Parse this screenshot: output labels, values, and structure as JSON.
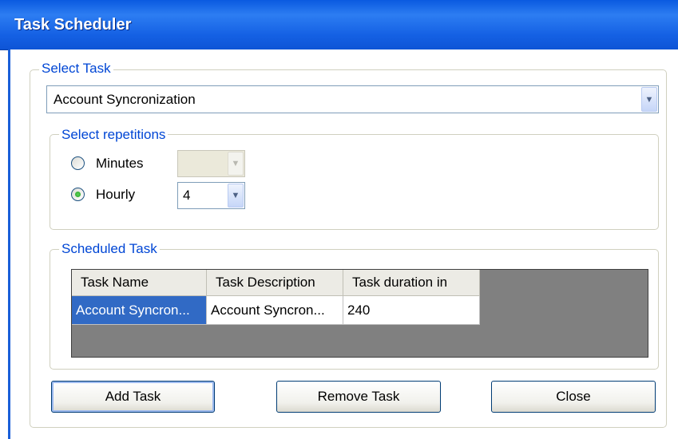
{
  "window": {
    "title": "Task Scheduler"
  },
  "select_task": {
    "legend": "Select Task",
    "value": "Account Syncronization"
  },
  "repetitions": {
    "legend": "Select repetitions",
    "minutes_label": "Minutes",
    "minutes_value": "",
    "hourly_label": "Hourly",
    "hourly_value": "4",
    "selected": "Hourly"
  },
  "scheduled": {
    "legend": "Scheduled Task",
    "columns": [
      "Task Name",
      "Task Description",
      "Task duration in"
    ],
    "rows": [
      [
        "Account Syncron...",
        "Account Syncron...",
        "240"
      ]
    ]
  },
  "buttons": {
    "add": "Add Task",
    "remove": "Remove Task",
    "close": "Close"
  },
  "colors": {
    "title_bar": "#1561e4",
    "group_legend": "#0046d5",
    "selection": "#316ac5"
  }
}
